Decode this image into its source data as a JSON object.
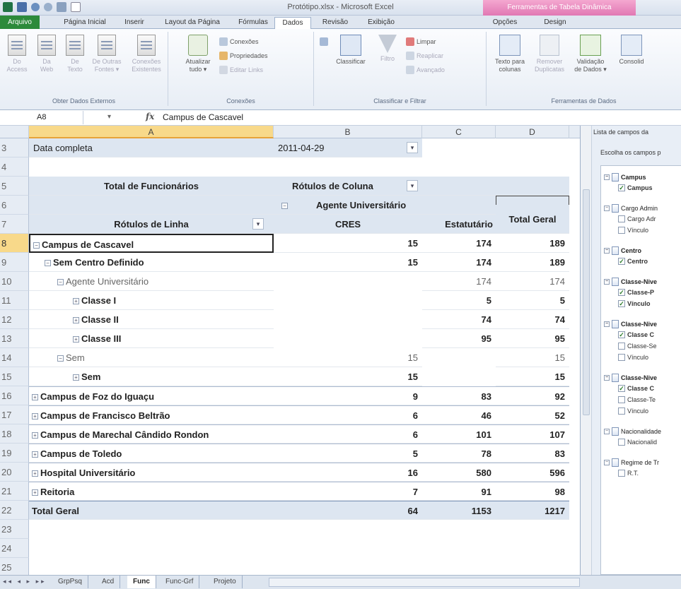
{
  "window": {
    "title": "Protótipo.xlsx - Microsoft Excel",
    "context_tab_title": "Ferramentas de Tabela Dinâmica"
  },
  "ribbon_tabs": [
    "Arquivo",
    "Página Inicial",
    "Inserir",
    "Layout da Página",
    "Fórmulas",
    "Dados",
    "Revisão",
    "Exibição",
    "Opções",
    "Design"
  ],
  "active_tab": "Dados",
  "ribbon": {
    "get_external": {
      "label": "Obter Dados Externos",
      "buttons": [
        {
          "line1": "Do",
          "line2": "Access"
        },
        {
          "line1": "Da",
          "line2": "Web"
        },
        {
          "line1": "De",
          "line2": "Texto"
        },
        {
          "line1": "De Outras",
          "line2": "Fontes ▾"
        },
        {
          "line1": "Conexões",
          "line2": "Existentes"
        }
      ]
    },
    "connections": {
      "label": "Conexões",
      "refresh_line1": "Atualizar",
      "refresh_line2": "tudo ▾",
      "items": [
        "Conexões",
        "Propriedades",
        "Editar Links"
      ]
    },
    "sort_filter": {
      "label": "Classificar e Filtrar",
      "sort": "Classificar",
      "filter": "Filtro",
      "items": [
        "Limpar",
        "Reaplicar",
        "Avançado"
      ]
    },
    "data_tools": {
      "label": "Ferramentas de Dados",
      "text_to_columns_line1": "Texto para",
      "text_to_columns_line2": "colunas",
      "remove_dup_line1": "Remover",
      "remove_dup_line2": "Duplicatas",
      "validation_line1": "Validação",
      "validation_line2": "de Dados ▾",
      "consolidate": "Consolid"
    }
  },
  "formula_bar": {
    "name_box": "A8",
    "fx": "fx",
    "content": "Campus de Cascavel"
  },
  "columns": [
    "A",
    "B",
    "C",
    "D"
  ],
  "rows": {
    "r3": {
      "num": "3",
      "a": "Data completa",
      "b": "2011-04-29"
    },
    "r4": {
      "num": "4"
    },
    "r5": {
      "num": "5",
      "a": "Total de Funcionários",
      "b": "Rótulos de Coluna"
    },
    "r6": {
      "num": "6",
      "b": "Agente Universitário"
    },
    "r7": {
      "num": "7",
      "a": "Rótulos de Linha",
      "b": "CRES",
      "c": "Estatutário",
      "d": "Total Geral"
    },
    "r8": {
      "num": "8",
      "a": "Campus de Cascavel",
      "b": "15",
      "c": "174",
      "d": "189"
    },
    "r9": {
      "num": "9",
      "a": "Sem Centro Definido",
      "b": "15",
      "c": "174",
      "d": "189"
    },
    "r10": {
      "num": "10",
      "a": "Agente Universitário",
      "c": "174",
      "d": "174"
    },
    "r11": {
      "num": "11",
      "a": "Classe I",
      "c": "5",
      "d": "5"
    },
    "r12": {
      "num": "12",
      "a": "Classe II",
      "c": "74",
      "d": "74"
    },
    "r13": {
      "num": "13",
      "a": "Classe III",
      "c": "95",
      "d": "95"
    },
    "r14": {
      "num": "14",
      "a": "Sem",
      "b": "15",
      "d": "15"
    },
    "r15": {
      "num": "15",
      "a": "Sem",
      "b": "15",
      "d": "15"
    },
    "r16": {
      "num": "16",
      "a": "Campus de Foz do Iguaçu",
      "b": "9",
      "c": "83",
      "d": "92"
    },
    "r17": {
      "num": "17",
      "a": "Campus de Francisco Beltrão",
      "b": "6",
      "c": "46",
      "d": "52"
    },
    "r18": {
      "num": "18",
      "a": "Campus de Marechal Cândido Rondon",
      "b": "6",
      "c": "101",
      "d": "107"
    },
    "r19": {
      "num": "19",
      "a": "Campus de Toledo",
      "b": "5",
      "c": "78",
      "d": "83"
    },
    "r20": {
      "num": "20",
      "a": "Hospital Universitário",
      "b": "16",
      "c": "580",
      "d": "596"
    },
    "r21": {
      "num": "21",
      "a": "Reitoria",
      "b": "7",
      "c": "91",
      "d": "98"
    },
    "r22": {
      "num": "22",
      "a": "Total Geral",
      "b": "64",
      "c": "1153",
      "d": "1217"
    },
    "r23": {
      "num": "23"
    },
    "r24": {
      "num": "24"
    },
    "r25": {
      "num": "25"
    }
  },
  "field_list": {
    "title": "Lista de campos da",
    "subtitle": "Escolha os campos p",
    "fields": [
      {
        "name": "Campus",
        "children": [
          {
            "name": "Campus",
            "checked": true
          }
        ]
      },
      {
        "name": "Cargo Admin",
        "children": [
          {
            "name": "Cargo Adr",
            "checked": false
          },
          {
            "name": "Vínculo",
            "checked": false
          }
        ]
      },
      {
        "name": "Centro",
        "children": [
          {
            "name": "Centro",
            "checked": true
          }
        ]
      },
      {
        "name": "Classe-Nive",
        "children": [
          {
            "name": "Classe-P",
            "checked": true
          },
          {
            "name": "Vínculo",
            "checked": true
          }
        ]
      },
      {
        "name": "Classe-Nive",
        "children": [
          {
            "name": "Classe C",
            "checked": true
          },
          {
            "name": "Classe-Se",
            "checked": false
          },
          {
            "name": "Vínculo",
            "checked": false
          }
        ]
      },
      {
        "name": "Classe-Nive",
        "children": [
          {
            "name": "Classe C",
            "checked": true
          },
          {
            "name": "Classe-Te",
            "checked": false
          },
          {
            "name": "Vínculo",
            "checked": false
          }
        ]
      },
      {
        "name": "Nacionalidade",
        "children": [
          {
            "name": "Nacionalid",
            "checked": false
          }
        ]
      },
      {
        "name": "Regime de Tr",
        "children": [
          {
            "name": "R.T.",
            "checked": false
          }
        ]
      }
    ]
  },
  "sheet_tabs": [
    "GrpPsq",
    "Acd",
    "Func",
    "Func-Grf",
    "Projeto"
  ],
  "active_sheet": "Func",
  "colors": {
    "selected_header": "#f8d98a",
    "pivot_header_bg": "#dde6f1",
    "file_tab": "#2c8a3a",
    "context_tab": "#e178b3"
  }
}
